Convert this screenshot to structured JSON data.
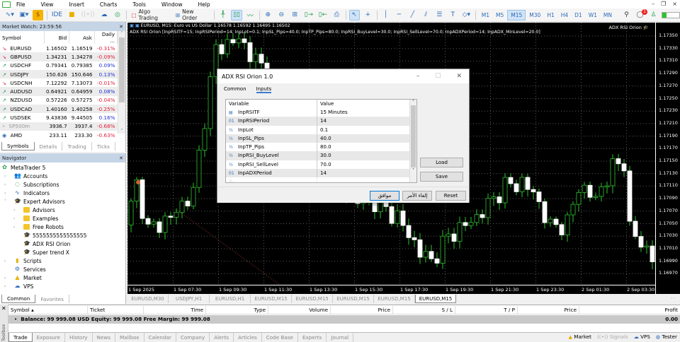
{
  "menu": [
    "File",
    "View",
    "Insert",
    "Charts",
    "Tools",
    "Window",
    "Help"
  ],
  "toolbar": {
    "ide": "IDE",
    "algo_trading": "Algo Trading",
    "new_order": "New Order",
    "timeframes": [
      "M1",
      "M5",
      "M15",
      "M30",
      "H1",
      "H4",
      "D1",
      "W1",
      "MN"
    ],
    "active_timeframe": "M15",
    "notifications": "1"
  },
  "market_watch": {
    "title": "Market Watch: 23:59:56",
    "columns": [
      "Symbol",
      "Bid",
      "Ask",
      "Daily ..."
    ],
    "rows": [
      {
        "symbol": "EURUSD",
        "bid": "1.16502",
        "ask": "1.16519",
        "daily": "-0.31%",
        "dir": "down"
      },
      {
        "symbol": "GBPUSD",
        "bid": "1.34231",
        "ask": "1.34278",
        "daily": "-0.09%",
        "dir": "down"
      },
      {
        "symbol": "USDCHF",
        "bid": "0.79341",
        "ask": "0.79385",
        "daily": "0.09%",
        "dir": "up"
      },
      {
        "symbol": "USDJPY",
        "bid": "150.626",
        "ask": "150.646",
        "daily": "0.13%",
        "dir": "up"
      },
      {
        "symbol": "USDCNH",
        "bid": "7.12292",
        "ask": "7.13073",
        "daily": "-0.01%",
        "dir": "down"
      },
      {
        "symbol": "AUDUSD",
        "bid": "0.64921",
        "ask": "0.64959",
        "daily": "0.08%",
        "dir": "up"
      },
      {
        "symbol": "NZDUSD",
        "bid": "0.57226",
        "ask": "0.57275",
        "daily": "-0.04%",
        "dir": "up"
      },
      {
        "symbol": "USDCAD",
        "bid": "1.40160",
        "ask": "1.40258",
        "daily": "-0.25%",
        "dir": "up"
      },
      {
        "symbol": "USDSEK",
        "bid": "9.43836",
        "ask": "9.44505",
        "daily": "0.16%",
        "dir": "up"
      },
      {
        "symbol": "SP500m",
        "bid": "3936.7",
        "ask": "3937.4",
        "daily": "-0.68%",
        "dir": "none"
      },
      {
        "symbol": "AMD",
        "bid": "233.11",
        "ask": "233.30",
        "daily": "-0.63%",
        "dir": "stock"
      }
    ],
    "tabs": [
      "Symbols",
      "Details",
      "Trading",
      "Ticks"
    ]
  },
  "navigator": {
    "title": "Navigator",
    "root": "MetaTrader 5",
    "items": [
      "Accounts",
      "Subscriptions",
      "Indicators",
      "Expert Advisors",
      "Advisors",
      "Examples",
      "Free Robots",
      "5555555555555555",
      "ADX RSI Orion",
      "Super trend X",
      "Scripts",
      "Services",
      "Market",
      "VPS"
    ],
    "tabs": [
      "Common",
      "Favorites"
    ]
  },
  "chart": {
    "header_line1": "EURUSD, M15:  Euro vs US Dollar  1.16578 1.16592 1.16495 1.16502",
    "header_line2": "ADX RSI Orion [InpRSITF=15; InpRSIPeriod=14; InpLot=0.1; InpSL_Pips=40.0; InpTP_Pips=80.0; InpRSI_BuyLevel=30.0; InpRSI_SellLevel=70.0; InpADXPeriod=14; InpADX_MinLevel=20.0]",
    "ea_label": "ADX RSI Orion",
    "price_labels": [
      "1.17350",
      "1.17330",
      "1.17310",
      "1.17290",
      "1.17270",
      "1.17250",
      "1.17230",
      "1.17210",
      "1.17190",
      "1.17170",
      "1.17150",
      "1.17130",
      "1.17110",
      "1.17090",
      "1.17070",
      "1.17050",
      "1.17030",
      "1.17010",
      "1.16990",
      "1.16970"
    ],
    "time_labels": [
      "1 Sep 2025",
      "1 Sep 07:30",
      "1 Sep 09:30",
      "1 Sep 11:30",
      "1 Sep 13:30",
      "1 Sep 15:30",
      "1 Sep 17:30",
      "1 Sep 19:30",
      "1 Sep 21:30",
      "1 Sep 23:30",
      "2 Sep 01:30",
      "2 Sep 03:30"
    ],
    "price_keypoints": [
      [
        0,
        1.17048
      ],
      [
        2,
        1.17112
      ],
      [
        4,
        1.1704
      ],
      [
        8,
        1.1706
      ],
      [
        12,
        1.171
      ],
      [
        14,
        1.1722
      ],
      [
        16,
        1.1733
      ],
      [
        20,
        1.17345
      ],
      [
        24,
        1.173
      ],
      [
        30,
        1.172
      ],
      [
        36,
        1.1712
      ],
      [
        40,
        1.1709
      ],
      [
        44,
        1.17085
      ],
      [
        48,
        1.1706
      ],
      [
        52,
        1.17005
      ],
      [
        54,
        1.1699
      ],
      [
        57,
        1.1703
      ],
      [
        62,
        1.1706
      ],
      [
        67,
        1.1711
      ],
      [
        70,
        1.17115
      ],
      [
        72,
        1.171
      ],
      [
        75,
        1.17045
      ],
      [
        78,
        1.1705
      ],
      [
        80,
        1.1711
      ],
      [
        83,
        1.1709
      ],
      [
        86,
        1.1714
      ],
      [
        88,
        1.1715
      ],
      [
        89,
        1.1704
      ],
      [
        91,
        1.1702
      ],
      [
        93,
        1.16995
      ]
    ],
    "tabs": [
      "EURUSD,M30",
      "USDJPY,H1",
      "EURUSD,H1",
      "EURUSD,M15",
      "EURUSD,M15",
      "EURUSD,M15",
      "EURUSD,M15",
      "EURUSD,M15"
    ]
  },
  "dialog": {
    "title": "ADX RSI Orion 1.0",
    "tabs": [
      "Common",
      "Inputs"
    ],
    "columns": [
      "Variable",
      "Value"
    ],
    "inputs": [
      {
        "icon": "enum",
        "name": "InpRSITF",
        "value": "15 Minutes"
      },
      {
        "icon": "01",
        "name": "InpRSIPeriod",
        "value": "14"
      },
      {
        "icon": "½",
        "name": "InpLot",
        "value": "0.1"
      },
      {
        "icon": "½",
        "name": "InpSL_Pips",
        "value": "40.0"
      },
      {
        "icon": "½",
        "name": "InpTP_Pips",
        "value": "80.0"
      },
      {
        "icon": "½",
        "name": "InpRSI_BuyLevel",
        "value": "30.0"
      },
      {
        "icon": "½",
        "name": "InpRSI_SellLevel",
        "value": "70.0"
      },
      {
        "icon": "01",
        "name": "InpADXPeriod",
        "value": "14"
      }
    ],
    "load": "Load",
    "save": "Save",
    "ok": "موافق",
    "cancel": "إلغاء الأمر",
    "reset": "Reset"
  },
  "toolbox": {
    "label": "Toolbox",
    "columns": [
      "Symbol",
      "Ticket",
      "Time",
      "Type",
      "Volume",
      "Price",
      "S / L",
      "T / P",
      "Price",
      "Profit"
    ],
    "balance": "Balance: 99 999.08 USD  Equity: 99 999.08  Free Margin: 99 999.08",
    "profit": "0.00",
    "tabs": [
      "Trade",
      "Exposure",
      "History",
      "News",
      "Mailbox",
      "Calendar",
      "Company",
      "Alerts",
      "Articles",
      "Code Base",
      "Experts",
      "Journal"
    ],
    "status": [
      "Market",
      "Signals",
      "VPS",
      "Tester"
    ]
  }
}
